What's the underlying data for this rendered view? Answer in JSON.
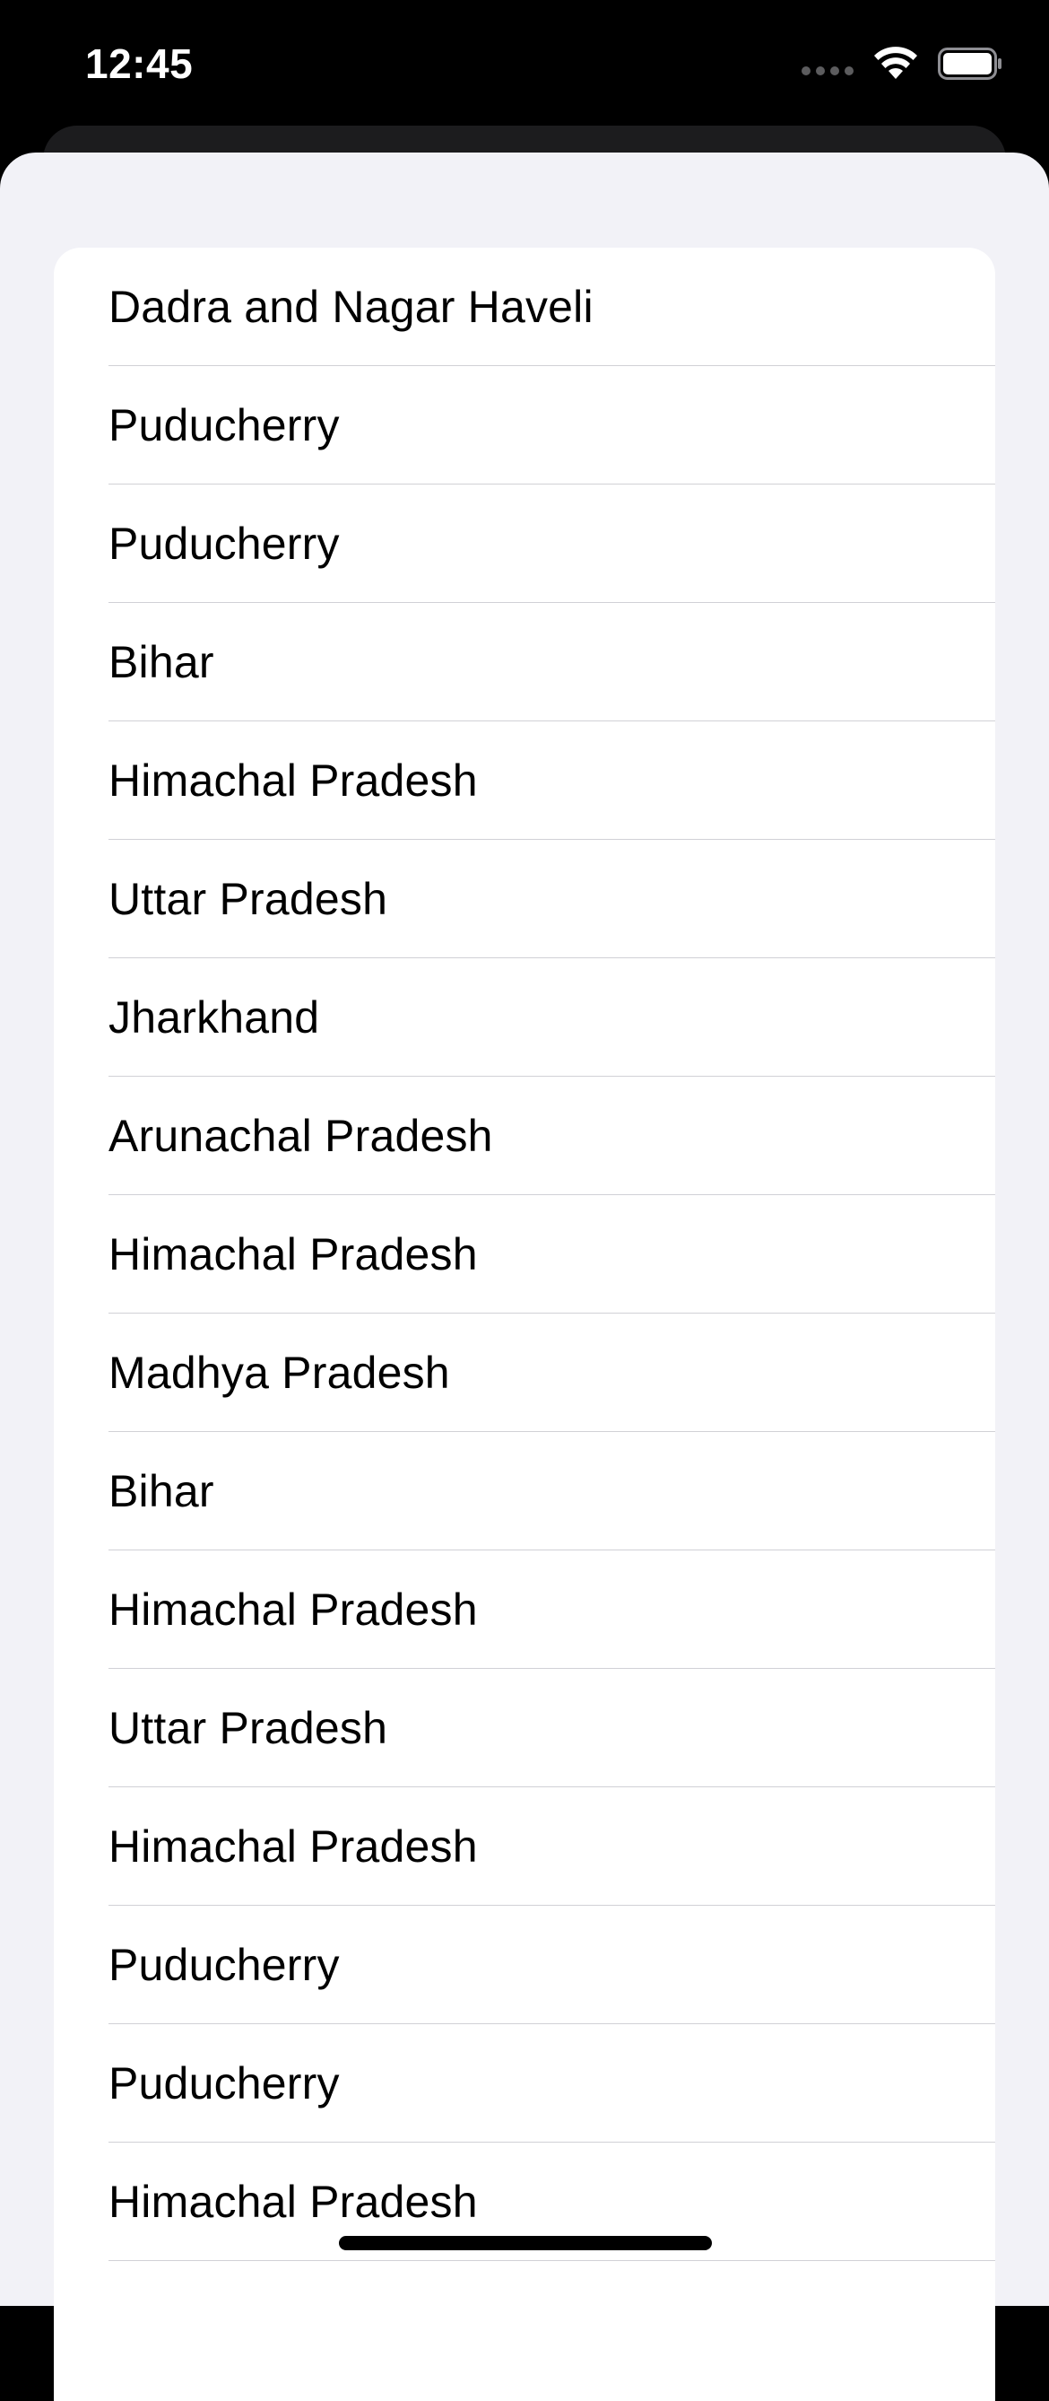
{
  "status_bar": {
    "time": "12:45",
    "icons": [
      "signal-dots-icon",
      "wifi-icon",
      "battery-icon"
    ]
  },
  "list": {
    "items": [
      {
        "label": "Dadra and Nagar Haveli"
      },
      {
        "label": "Puducherry"
      },
      {
        "label": "Puducherry"
      },
      {
        "label": "Bihar"
      },
      {
        "label": "Himachal Pradesh"
      },
      {
        "label": "Uttar Pradesh"
      },
      {
        "label": "Jharkhand"
      },
      {
        "label": "Arunachal Pradesh"
      },
      {
        "label": "Himachal Pradesh"
      },
      {
        "label": "Madhya Pradesh"
      },
      {
        "label": "Bihar"
      },
      {
        "label": "Himachal Pradesh"
      },
      {
        "label": "Uttar Pradesh"
      },
      {
        "label": "Himachal Pradesh"
      },
      {
        "label": "Puducherry"
      },
      {
        "label": "Puducherry"
      },
      {
        "label": "Himachal Pradesh"
      }
    ]
  },
  "colors": {
    "sheet_background": "#f2f2f7",
    "card_background": "#ffffff",
    "separator": "#d1d1d6",
    "status_bar_background": "#000000"
  }
}
